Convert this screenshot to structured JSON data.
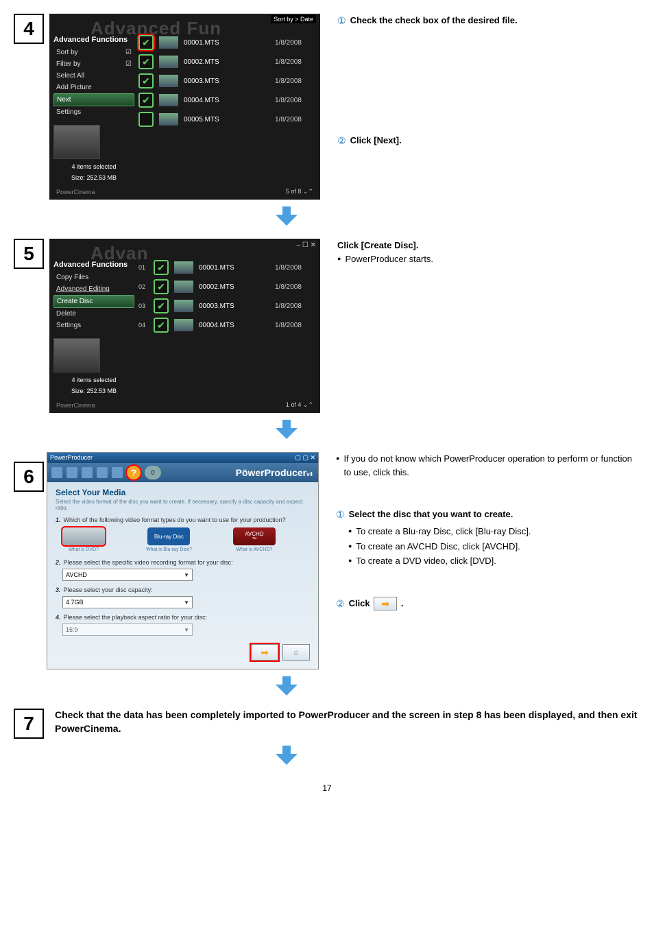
{
  "steps": {
    "s4": {
      "num": "4",
      "sortby_tag": "Sort by > Date",
      "wm": "Advanced Fun",
      "sidebar_hdr": "Advanced Functions",
      "menu": {
        "sortby": "Sort by",
        "filterby": "Filter by",
        "selectall": "Select All",
        "addpic": "Add Picture",
        "next": "Next",
        "settings": "Settings"
      },
      "check_glyph": "☑",
      "status1": "4 items selected",
      "status2": "Size: 252.53 MB",
      "footer_brand": "PowerCinema",
      "footer_count": "5 of 8",
      "rows": [
        {
          "name": "00001.MTS",
          "date": "1/8/2008",
          "checked": true
        },
        {
          "name": "00002.MTS",
          "date": "1/8/2008",
          "checked": true
        },
        {
          "name": "00003.MTS",
          "date": "1/8/2008",
          "checked": true
        },
        {
          "name": "00004.MTS",
          "date": "1/8/2008",
          "checked": true
        },
        {
          "name": "00005.MTS",
          "date": "1/8/2008",
          "checked": false
        }
      ],
      "instr1": "Check the check box of the desired file.",
      "instr2": "Click [Next]."
    },
    "s5": {
      "num": "5",
      "wm": "Advan",
      "win_controls": "– ☐ ✕",
      "sidebar_hdr": "Advanced Functions",
      "menu": {
        "copy": "Copy Files",
        "advedit": "Advanced Editing",
        "create": "Create Disc",
        "delete": "Delete",
        "settings": "Settings"
      },
      "status1": "4 items selected",
      "status2": "Size: 252.53 MB",
      "footer_brand": "PowerCinema",
      "footer_count": "1 of 4",
      "rows": [
        {
          "idx": "01",
          "name": "00001.MTS",
          "date": "1/8/2008"
        },
        {
          "idx": "02",
          "name": "00002.MTS",
          "date": "1/8/2008"
        },
        {
          "idx": "03",
          "name": "00003.MTS",
          "date": "1/8/2008"
        },
        {
          "idx": "04",
          "name": "00004.MTS",
          "date": "1/8/2008"
        }
      ],
      "hdr": "Click [Create Disc].",
      "bullet": "PowerProducer starts."
    },
    "s6": {
      "num": "6",
      "titlebar": "PowerProducer",
      "win_btns": "▢ ▢ ✕",
      "help": "?",
      "zero": "0",
      "logo": "PöwerProducer",
      "logo_suffix": "v4",
      "heading": "Select Your Media",
      "sub": "Select the video format of the disc you want to create. If necessary, specify a disc capacity and aspect ratio.",
      "q1_num": "1.",
      "q1": "Which of the following video format types do you want to use for your production?",
      "dvd_label": "DVD",
      "bd_label": "Blu-ray Disc",
      "avchd_label": "AVCHD",
      "what_dvd": "What is DVD?",
      "what_bd": "What is Blu-ray Disc?",
      "what_avchd": "What is AVCHD?",
      "q2_num": "2.",
      "q2": "Please select the specific video recording format for your disc:",
      "sel2": "AVCHD",
      "q3_num": "3.",
      "q3": "Please select your disc capacity:",
      "sel3": "4.7GB",
      "q4_num": "4.",
      "q4": "Please select the playback aspect ratio for your disc:",
      "sel4": "16:9",
      "tip": "If you do not know which PowerProducer operation to perform or function to use, click this.",
      "instr1": "Select the disc that you want to create.",
      "b1": "To create a Blu-ray Disc, click [Blu-ray Disc].",
      "b2": "To create an AVCHD Disc, click [AVCHD].",
      "b3": "To create a DVD video, click [DVD].",
      "instr2a": "Click",
      "instr2b": "."
    },
    "s7": {
      "num": "7",
      "text": "Check that the data has been completely imported to PowerProducer and the screen in step 8 has been displayed, and then exit PowerCinema."
    }
  },
  "circles": {
    "c1": "①",
    "c2": "②"
  },
  "page": "17"
}
